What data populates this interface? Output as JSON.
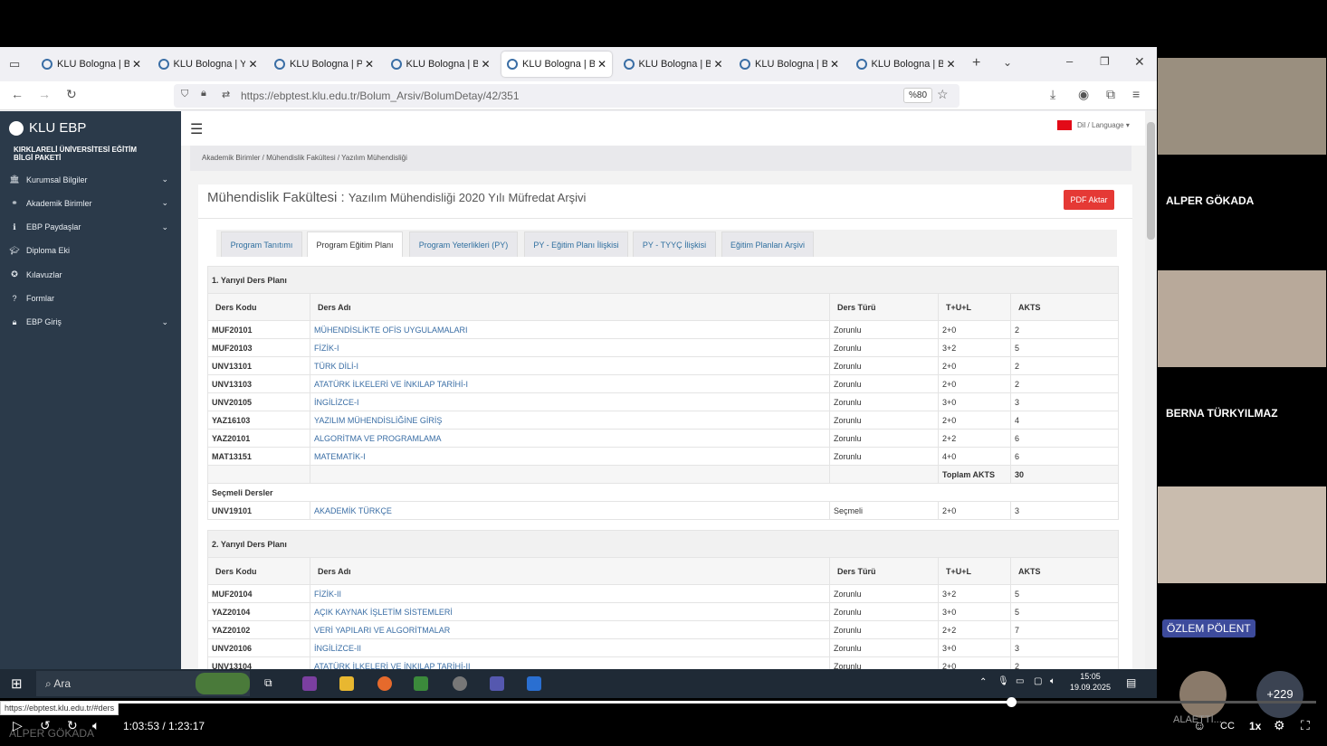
{
  "tabs": [
    {
      "label": "KLU Bologna | Bilg",
      "active": false
    },
    {
      "label": "KLU Bologna | Yetkili G",
      "active": false
    },
    {
      "label": "KLU Bologna | Pro",
      "active": false
    },
    {
      "label": "KLU Bologna | Bilg",
      "active": false
    },
    {
      "label": "KLU Bologna | Bilg",
      "active": true
    },
    {
      "label": "KLU Bologna | Bilg",
      "active": false
    },
    {
      "label": "KLU Bologna | Bilg",
      "active": false
    },
    {
      "label": "KLU Bologna | Bilg",
      "active": false
    }
  ],
  "url": "https://ebptest.klu.edu.tr/Bolum_Arsiv/BolumDetay/42/351",
  "zoom": "%80",
  "brand": "KLU EBP",
  "university": "KIRKLARELİ ÜNİVERSİTESİ EĞİTİM BİLGİ PAKETİ",
  "sidebar": [
    {
      "label": "Kurumsal Bilgiler",
      "icon": "institution-icon",
      "chevron": true
    },
    {
      "label": "Akademik Birimler",
      "icon": "sitemap-icon",
      "chevron": true
    },
    {
      "label": "EBP Paydaşlar",
      "icon": "info-icon",
      "chevron": true
    },
    {
      "label": "Diploma Eki",
      "icon": "graduation-cap-icon",
      "chevron": false
    },
    {
      "label": "Kılavuzlar",
      "icon": "compass-icon",
      "chevron": false
    },
    {
      "label": "Formlar",
      "icon": "question-icon",
      "chevron": false
    },
    {
      "label": "EBP Giriş",
      "icon": "lock-icon",
      "chevron": true
    }
  ],
  "language": "Dil / Language",
  "breadcrumb": "Akademik Birimler  /  Mühendislik Fakültesi  /  Yazılım Mühendisliği",
  "page_title": "Mühendislik Fakültesi :",
  "page_subtitle": "Yazılım Mühendisliği 2020 Yılı Müfredat Arşivi",
  "pdf_button": "PDF Aktar",
  "page_tabs": [
    "Program Tanıtımı",
    "Program Eğitim Planı",
    "Program Yeterlikleri (PY)",
    "PY - Eğitim Planı İlişkisi",
    "PY - TYYÇ İlişkisi",
    "Eğitim Planları Arşivi"
  ],
  "columns": [
    "Ders Kodu",
    "Ders Adı",
    "Ders Türü",
    "T+U+L",
    "AKTS"
  ],
  "semester1": {
    "title": "1. Yarıyıl Ders Planı",
    "rows": [
      [
        "MUF20101",
        "MÜHENDİSLİKTE OFİS UYGULAMALARI",
        "Zorunlu",
        "2+0",
        "2"
      ],
      [
        "MUF20103",
        "FİZİK-I",
        "Zorunlu",
        "3+2",
        "5"
      ],
      [
        "UNV13101",
        "TÜRK DİLİ-I",
        "Zorunlu",
        "2+0",
        "2"
      ],
      [
        "UNV13103",
        "ATATÜRK İLKELERİ VE İNKILAP TARİHİ-I",
        "Zorunlu",
        "2+0",
        "2"
      ],
      [
        "UNV20105",
        "İNGİLİZCE-I",
        "Zorunlu",
        "3+0",
        "3"
      ],
      [
        "YAZ16103",
        "YAZILIM MÜHENDİSLİĞİNE GİRİŞ",
        "Zorunlu",
        "2+0",
        "4"
      ],
      [
        "YAZ20101",
        "ALGORİTMA VE PROGRAMLAMA",
        "Zorunlu",
        "2+2",
        "6"
      ],
      [
        "MAT13151",
        "MATEMATİK-I",
        "Zorunlu",
        "4+0",
        "6"
      ]
    ],
    "total_label": "Toplam AKTS",
    "total": "30",
    "elective_title": "Seçmeli Dersler",
    "electives": [
      [
        "UNV19101",
        "AKADEMİK TÜRKÇE",
        "Seçmeli",
        "2+0",
        "3"
      ]
    ]
  },
  "semester2": {
    "title": "2. Yarıyıl Ders Planı",
    "rows": [
      [
        "MUF20104",
        "FİZİK-II",
        "Zorunlu",
        "3+2",
        "5"
      ],
      [
        "YAZ20104",
        "AÇIK KAYNAK İŞLETİM SİSTEMLERİ",
        "Zorunlu",
        "3+0",
        "5"
      ],
      [
        "YAZ20102",
        "VERİ YAPILARI VE ALGORİTMALAR",
        "Zorunlu",
        "2+2",
        "7"
      ],
      [
        "UNV20106",
        "İNGİLİZCE-II",
        "Zorunlu",
        "3+0",
        "3"
      ],
      [
        "UNV13104",
        "ATATÜRK İLKELERİ VE İNKILAP TARİHİ-II",
        "Zorunlu",
        "2+0",
        "2"
      ]
    ]
  },
  "status_url": "https://ebptest.klu.edu.tr/#ders",
  "taskbar": {
    "search": "Ara",
    "time": "15:05",
    "date": "19.09.2025"
  },
  "participants": [
    "ALPER GÖKADA",
    "BERNA TÜRKYILMAZ",
    "ÖZLEM PÖLENT"
  ],
  "extra_participants": "+229",
  "partial_name": "ALAETTİ...",
  "video": {
    "time": "1:03:53 / 1:23:17",
    "speed": "1x",
    "progress": 0.7705,
    "watermark": "ALPER GÖKADA"
  }
}
